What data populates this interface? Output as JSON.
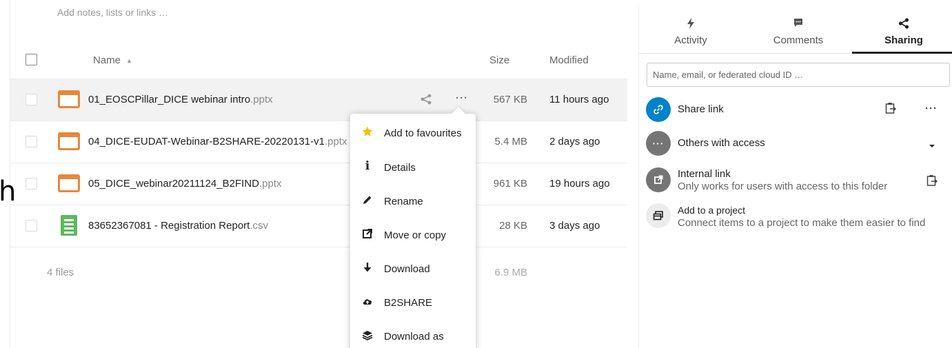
{
  "notes": {
    "placeholder": "Add notes, lists or links …"
  },
  "edge_text": "h",
  "table": {
    "headers": {
      "name": "Name",
      "size": "Size",
      "modified": "Modified"
    },
    "rows": [
      {
        "name": "01_EOSCPillar_DICE webinar intro",
        "ext": ".pptx",
        "type": "pptx",
        "size": "567 KB",
        "modified": "11 hours ago"
      },
      {
        "name": "04_DICE-EUDAT-Webinar-B2SHARE-20220131-v1",
        "ext": ".pptx",
        "type": "pptx",
        "size": "5.4 MB",
        "modified": "2 days ago"
      },
      {
        "name": "05_DICE_webinar20211124_B2FIND",
        "ext": ".pptx",
        "type": "pptx",
        "size": "961 KB",
        "modified": "19 hours ago"
      },
      {
        "name": "83652367081 - Registration Report",
        "ext": ".csv",
        "type": "csv",
        "size": "28 KB",
        "modified": "3 days ago"
      }
    ],
    "summary": {
      "count": "4 files",
      "total": "6.9 MB"
    }
  },
  "context_menu": {
    "items": [
      {
        "label": "Add to favourites",
        "icon": "star-icon"
      },
      {
        "label": "Details",
        "icon": "info-icon"
      },
      {
        "label": "Rename",
        "icon": "pencil-icon"
      },
      {
        "label": "Move or copy",
        "icon": "external-link-icon"
      },
      {
        "label": "Download",
        "icon": "download-arrow-icon"
      },
      {
        "label": "B2SHARE",
        "icon": "cloud-upload-icon"
      },
      {
        "label": "Download as",
        "icon": "layers-icon"
      }
    ]
  },
  "sidebar": {
    "tabs": [
      {
        "label": "Activity",
        "icon": "lightning-icon"
      },
      {
        "label": "Comments",
        "icon": "comment-icon"
      },
      {
        "label": "Sharing",
        "icon": "share-icon",
        "active": true
      }
    ],
    "share_input_placeholder": "Name, email, or federated cloud ID …",
    "share_link": {
      "label": "Share link"
    },
    "others_access": {
      "label": "Others with access"
    },
    "internal_link": {
      "title": "Internal link",
      "subtitle": "Only works for users with access to this folder"
    },
    "project": {
      "title": "Add to a project",
      "subtitle": "Connect items to a project to make them easier to find"
    }
  },
  "colors": {
    "accent_blue": "#0082c9",
    "pptx_orange": "#e7873a",
    "csv_green": "#5cb85c",
    "star_yellow": "#f5c000",
    "grey_avatar": "#757575"
  }
}
